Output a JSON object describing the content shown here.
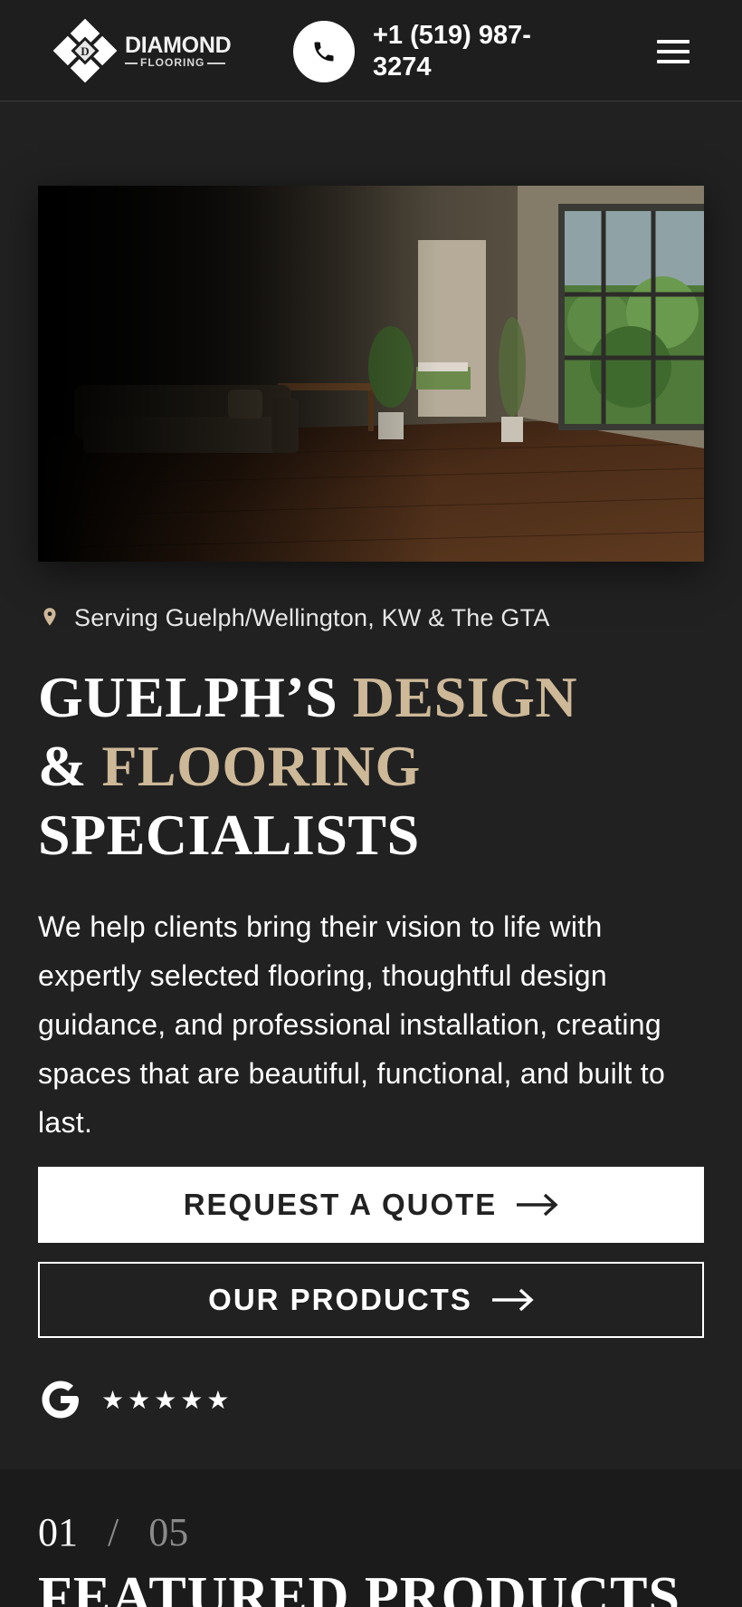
{
  "header": {
    "logo": {
      "name": "DIAMOND",
      "sub": "FLOORING",
      "mark_letter": "D"
    },
    "phone": "+1 (519) 987-3274",
    "icons": {
      "phone": "phone-icon",
      "menu": "hamburger-menu-icon"
    }
  },
  "hero": {
    "image_alt": "Living room with dark hardwood flooring",
    "location": "Serving Guelph/Wellington, KW & The GTA",
    "headline": {
      "line1_a": "GUELPH’S ",
      "line1_b": "DESIGN",
      "line2_a": "& ",
      "line2_b": "FLOORING",
      "line3": "SPECIALISTS"
    },
    "description": "We help clients bring their vision to life with expertly selected flooring, thoughtful design guidance, and professional installation, creating spaces that are beautiful, functional, and built to last.",
    "buttons": {
      "quote": "REQUEST A QUOTE",
      "products": "OUR PRODUCTS"
    },
    "rating": {
      "stars": "★★★★★",
      "value": 5
    }
  },
  "featured": {
    "current": "01",
    "separator": "/",
    "total": "05",
    "title": "FEATURED PRODUCTS"
  },
  "colors": {
    "background": "#212121",
    "accent": "#cdb898",
    "text": "#ffffff"
  }
}
